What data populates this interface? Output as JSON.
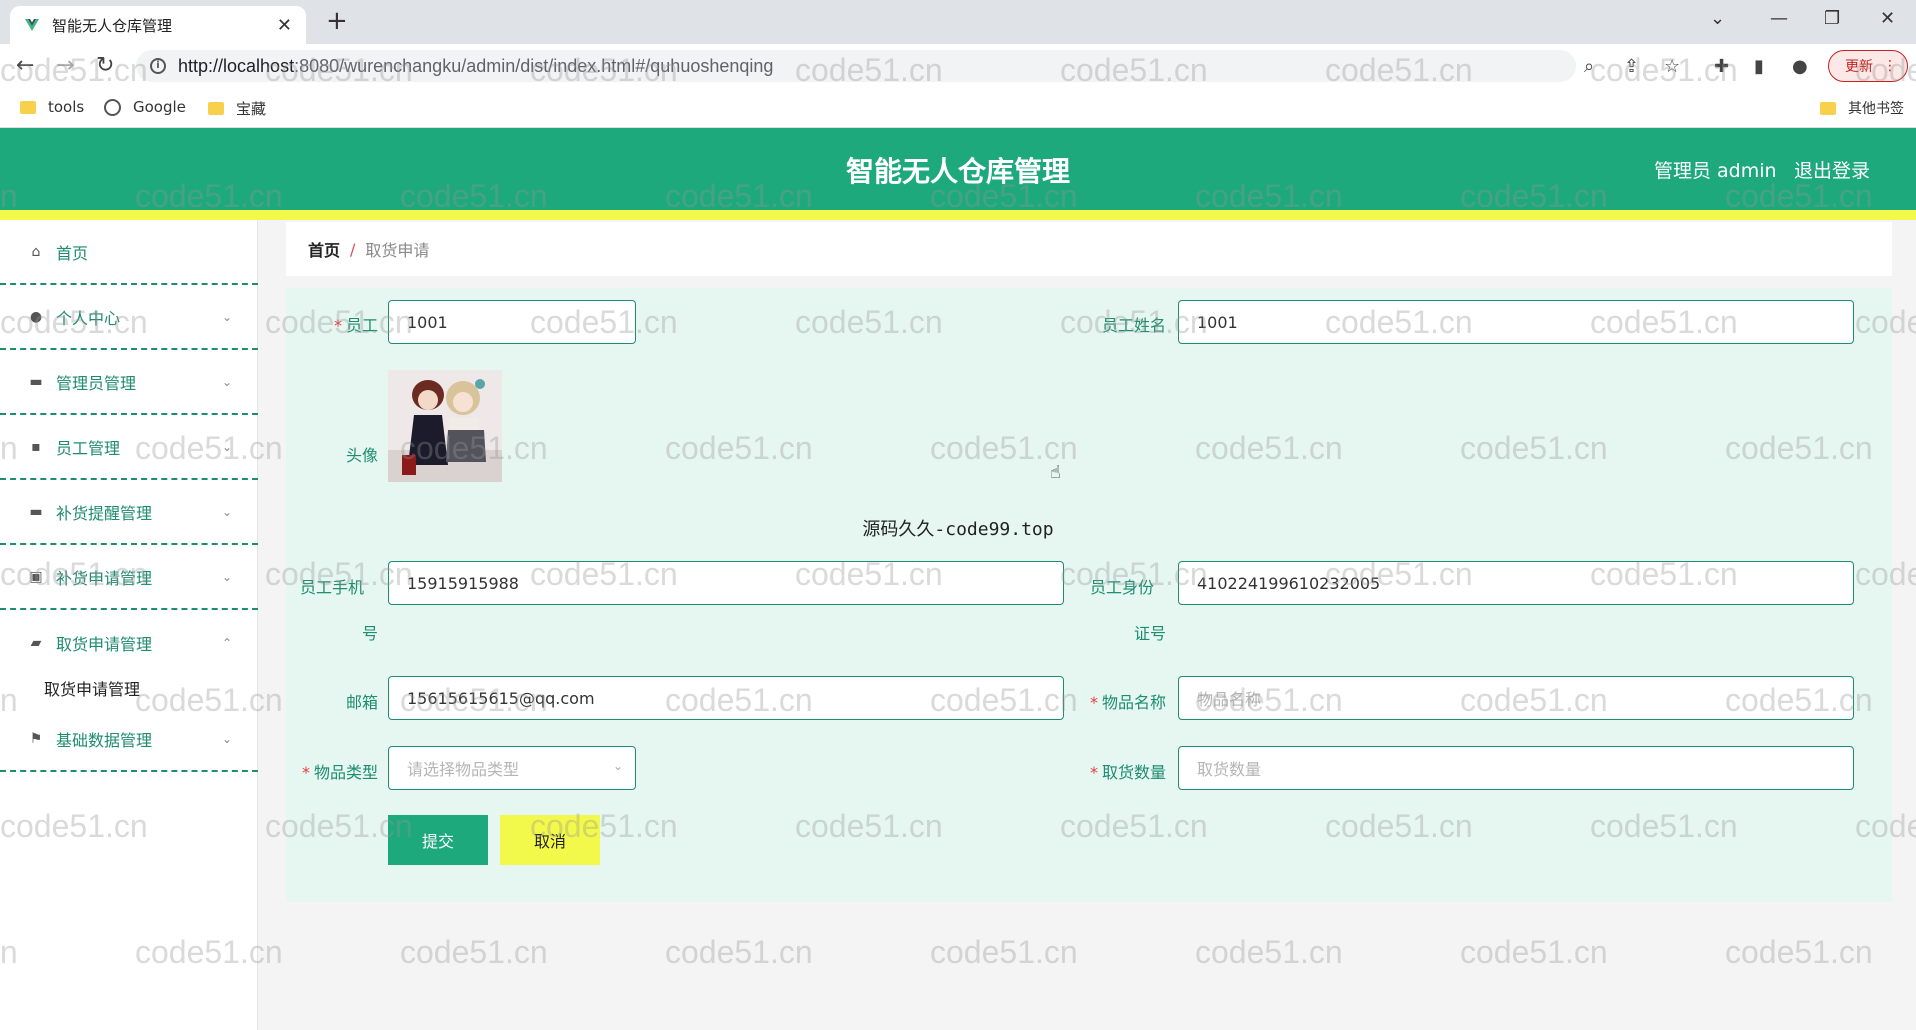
{
  "browser": {
    "tab_title": "智能无人仓库管理",
    "url_host": "http://localhost",
    "url_rest": ":8080/wurenchangku/admin/dist/index.html#/quhuoshenqing",
    "update_label": "更新",
    "bookmarks": [
      "tools",
      "Google",
      "宝藏"
    ],
    "other_bookmarks": "其他书签"
  },
  "header": {
    "title": "智能无人仓库管理",
    "user_label": "管理员 admin",
    "logout_label": "退出登录"
  },
  "sidebar": {
    "items": [
      {
        "label": "首页",
        "icon": "home-icon"
      },
      {
        "label": "个人中心",
        "icon": "person-icon"
      },
      {
        "label": "管理员管理",
        "icon": "briefcase-icon"
      },
      {
        "label": "员工管理",
        "icon": "chat-icon"
      },
      {
        "label": "补货提醒管理",
        "icon": "box-icon"
      },
      {
        "label": "补货申请管理",
        "icon": "form-icon"
      },
      {
        "label": "取货申请管理",
        "icon": "truck-icon"
      },
      {
        "label": "基础数据管理",
        "icon": "flag-icon"
      }
    ],
    "submenu_label": "取货申请管理"
  },
  "breadcrumb": {
    "home": "首页",
    "separator": "/",
    "current": "取货申请"
  },
  "form": {
    "employee_label": "员工",
    "employee_value": "1001",
    "employee_name_label": "员工姓名",
    "employee_name_value": "1001",
    "avatar_label": "头像",
    "phone_label_1": "员工手机",
    "phone_label_2": "号",
    "phone_value": "15915915988",
    "id_label_1": "员工身份",
    "id_label_2": "证号",
    "id_value": "410224199610232005",
    "email_label": "邮箱",
    "email_value": "15615615615@qq.com",
    "item_name_label": "物品名称",
    "item_name_placeholder": "物品名称",
    "item_type_label": "物品类型",
    "item_type_placeholder": "请选择物品类型",
    "quantity_label": "取货数量",
    "quantity_placeholder": "取货数量",
    "submit_label": "提交",
    "cancel_label": "取消"
  },
  "note": "源码久久-code99.top",
  "watermark": "code51.cn",
  "colors": {
    "primary": "#1ea97c",
    "accent_yellow": "#f3f94b",
    "panel_bg": "#e6f7f1"
  }
}
